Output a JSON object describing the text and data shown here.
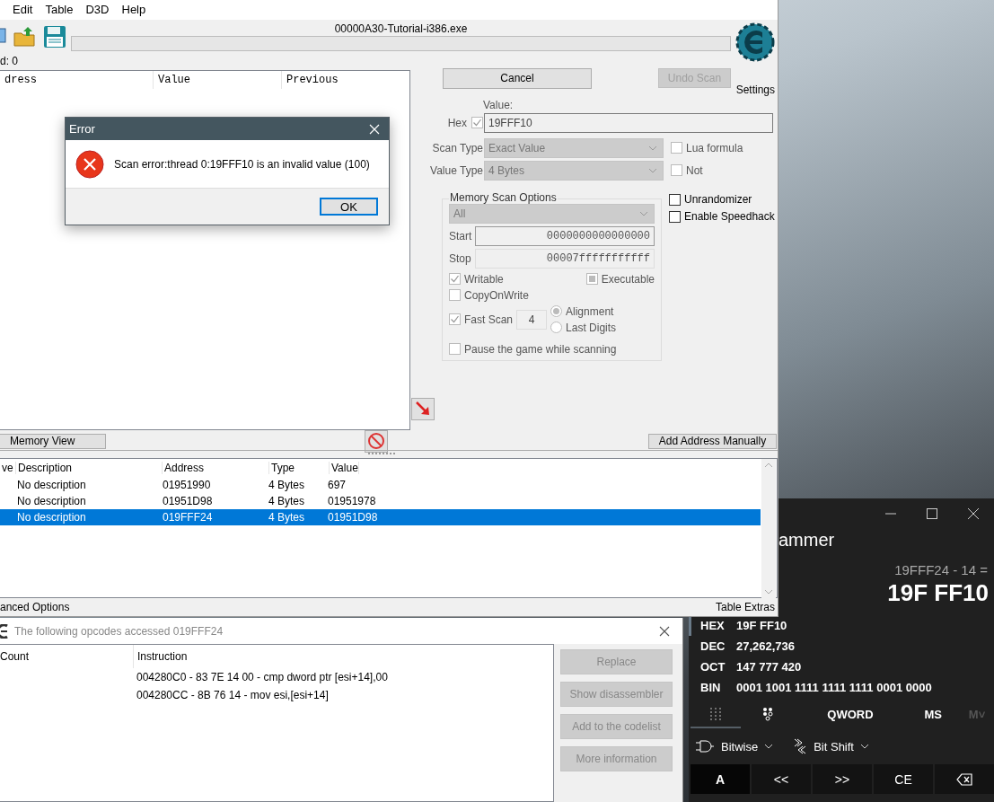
{
  "main_window": {
    "menu": [
      {
        "label": "Edit"
      },
      {
        "label": "Table"
      },
      {
        "label": "D3D"
      },
      {
        "label": "Help"
      }
    ],
    "process_title": "00000A30-Tutorial-i386.exe",
    "scan_progress": {
      "level": 0
    },
    "settings_label": "Settings",
    "found_label": "d: 0",
    "results_columns": [
      "dress",
      "Value",
      "Previous"
    ],
    "scan_buttons": [
      {
        "label": "Cancel",
        "disabled": false
      },
      {
        "label": "Undo Scan",
        "disabled": true
      }
    ],
    "value": {
      "label": "Value:",
      "hex_label": "Hex",
      "hex_checked": true,
      "text": "19FFF10"
    },
    "dropdowns": [
      {
        "label": "Scan Type",
        "value": "Exact Value",
        "flag": {
          "label": "Lua formula",
          "checked": false
        }
      },
      {
        "label": "Value Type",
        "value": "4 Bytes",
        "flag": {
          "label": "Not",
          "checked": false
        }
      }
    ],
    "extra_flags": [
      {
        "label": "Unrandomizer",
        "checked": false
      },
      {
        "label": "Enable Speedhack",
        "checked": false
      }
    ],
    "memory_scan_options": {
      "title": "Memory Scan Options",
      "region": "All",
      "ranges": [
        {
          "label": "Start",
          "value": "0000000000000000"
        },
        {
          "label": "Stop",
          "value": "00007fffffffffff"
        }
      ],
      "protection": [
        {
          "label": "Writable",
          "checked": true
        },
        {
          "label": "Executable",
          "checked": false,
          "indeterminate": true
        },
        {
          "label": "CopyOnWrite",
          "checked": false
        }
      ],
      "fast_scan": {
        "label": "Fast Scan",
        "checked": true,
        "value": "4"
      },
      "alignment": [
        {
          "label": "Alignment",
          "selected": true
        },
        {
          "label": "Last Digits",
          "selected": false
        }
      ],
      "pause": {
        "label": "Pause the game while scanning",
        "checked": false
      }
    },
    "memory_view_button": "Memory View",
    "add_address_button": "Add Address Manually",
    "address_table": {
      "columns": [
        "ve",
        "Description",
        "Address",
        "Type",
        "Value"
      ],
      "rows": [
        {
          "cells": [
            "",
            "No description",
            "01951990",
            "4 Bytes",
            "697"
          ],
          "selected": false
        },
        {
          "cells": [
            "",
            "No description",
            "01951D98",
            "4 Bytes",
            "01951978"
          ],
          "selected": false
        },
        {
          "cells": [
            "",
            "No description",
            "019FFF24",
            "4 Bytes",
            "01951D98"
          ],
          "selected": true
        }
      ]
    },
    "status_left": "anced Options",
    "status_right": "Table Extras"
  },
  "error_dialog": {
    "title": "Error",
    "message": "Scan error:thread 0:19FFF10 is an invalid value (100)",
    "button": "OK"
  },
  "opcodes_window": {
    "title": "The following opcodes accessed 019FFF24",
    "columns": [
      "Count",
      "Instruction"
    ],
    "rows": [
      {
        "instruction": "004280C0 - 83 7E 14 00 - cmp dword ptr [esi+14],00"
      },
      {
        "instruction": "004280CC - 8B 76 14  - mov esi,[esi+14]"
      }
    ],
    "buttons": [
      {
        "label": "Replace",
        "disabled": true
      },
      {
        "label": "Show disassembler",
        "disabled": true
      },
      {
        "label": "Add to the codelist",
        "disabled": true
      },
      {
        "label": "More information",
        "disabled": true
      }
    ]
  },
  "calculator": {
    "title": "ammer",
    "expression": "19FFF24 - 14 =",
    "result": "19F FF10",
    "radix": [
      {
        "label": "HEX",
        "value": "19F FF10",
        "selected": true
      },
      {
        "label": "DEC",
        "value": "27,262,736",
        "selected": false
      },
      {
        "label": "OCT",
        "value": "147 777 420",
        "selected": false
      },
      {
        "label": "BIN",
        "value": "0001 1001 1111 1111 1111 0001 0000",
        "selected": false
      }
    ],
    "tabs": [
      {
        "kind": "keypad",
        "selected": true
      },
      {
        "kind": "bits",
        "selected": false
      },
      {
        "kind": "text",
        "label": "QWORD",
        "selected": false,
        "disabled": false
      },
      {
        "kind": "text",
        "label": "MS",
        "selected": false,
        "disabled": false
      },
      {
        "kind": "text",
        "label": "M˅",
        "selected": false,
        "disabled": true
      }
    ],
    "menus": [
      {
        "kind": "bitwise",
        "label": "Bitwise"
      },
      {
        "kind": "bitshift",
        "label": "Bit Shift"
      }
    ],
    "keys": [
      {
        "kind": "text",
        "label": "A",
        "selected": true
      },
      {
        "kind": "text",
        "label": "<<",
        "selected": false
      },
      {
        "kind": "text",
        "label": ">>",
        "selected": false
      },
      {
        "kind": "text",
        "label": "CE",
        "selected": false
      },
      {
        "kind": "backspace",
        "selected": false
      }
    ]
  }
}
